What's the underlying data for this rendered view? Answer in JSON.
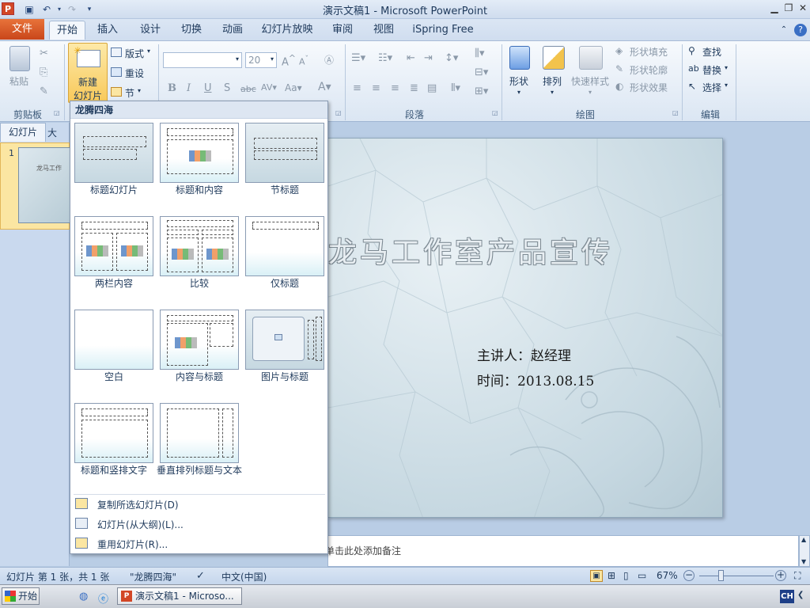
{
  "window": {
    "title": "演示文稿1 - Microsoft PowerPoint",
    "app_icon_letter": "P"
  },
  "tabs": {
    "file": "文件",
    "items": [
      "开始",
      "插入",
      "设计",
      "切换",
      "动画",
      "幻灯片放映",
      "审阅",
      "视图",
      "iSpring Free"
    ]
  },
  "ribbon": {
    "clipboard": {
      "paste": "粘贴",
      "label": "剪贴板"
    },
    "slides": {
      "new_slide_line1": "新建",
      "new_slide_line2": "幻灯片",
      "layout": "版式",
      "reset": "重设",
      "section": "节"
    },
    "font": {
      "font_name": "",
      "font_size": "20"
    },
    "paragraph": {
      "label": "段落"
    },
    "drawing": {
      "shape": "形状",
      "arrange": "排列",
      "quick_styles": "快速样式",
      "shape_fill": "形状填充",
      "shape_outline": "形状轮廓",
      "shape_effects": "形状效果",
      "label": "绘图"
    },
    "editing": {
      "find": "查找",
      "replace": "替换",
      "select": "选择",
      "label": "编辑"
    }
  },
  "left_panel": {
    "tab_slides": "幻灯片",
    "tab_outline": "大",
    "slide_number": "1",
    "thumb_text": "龙马工作"
  },
  "slide": {
    "title": "龙马工作室产品宣传",
    "presenter": "主讲人：赵经理",
    "time": "时间：2013.08.15"
  },
  "notes": {
    "text": "单击此处添加备注"
  },
  "gallery": {
    "theme_name": "龙腾四海",
    "layouts": [
      {
        "label": "标题幻灯片"
      },
      {
        "label": "标题和内容"
      },
      {
        "label": "节标题"
      },
      {
        "label": "两栏内容"
      },
      {
        "label": "比较"
      },
      {
        "label": "仅标题"
      },
      {
        "label": "空白"
      },
      {
        "label": "内容与标题"
      },
      {
        "label": "图片与标题"
      },
      {
        "label": "标题和竖排文字"
      },
      {
        "label": "垂直排列标题与文本"
      }
    ],
    "menu": [
      {
        "label": "复制所选幻灯片(D)"
      },
      {
        "label": "幻灯片(从大纲)(L)..."
      },
      {
        "label": "重用幻灯片(R)..."
      }
    ]
  },
  "status": {
    "slide_info": "幻灯片 第 1 张，共 1 张",
    "theme": "\"龙腾四海\"",
    "language": "中文(中国)",
    "zoom": "67%"
  },
  "taskbar": {
    "start": "开始",
    "ppt_task": "演示文稿1 - Microso...",
    "ime": "CH"
  }
}
